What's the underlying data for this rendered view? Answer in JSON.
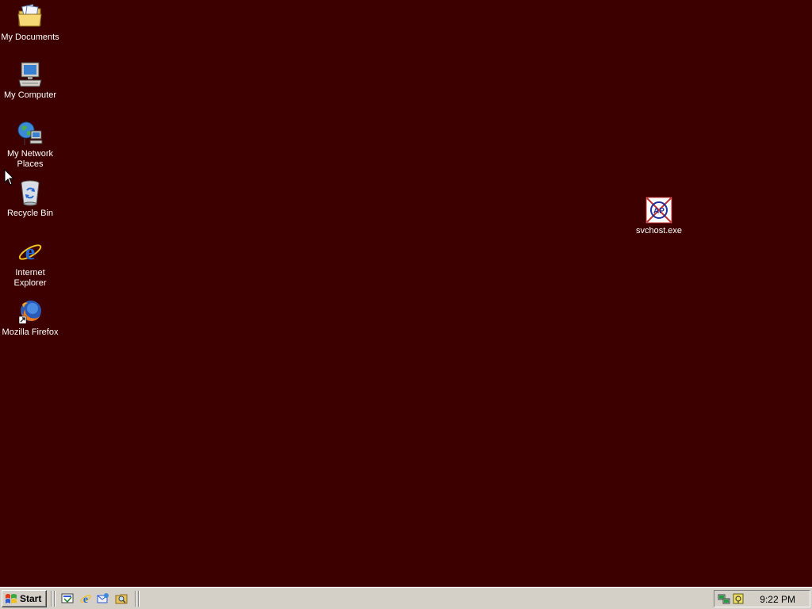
{
  "desktop": {
    "background_color": "#3c0000",
    "icons": [
      {
        "label": "My Documents",
        "icon": "folder-documents-icon"
      },
      {
        "label": "My Computer",
        "icon": "computer-icon"
      },
      {
        "label": "My Network\nPlaces",
        "icon": "network-places-icon"
      },
      {
        "label": "Recycle Bin",
        "icon": "recycle-bin-icon"
      },
      {
        "label": "Internet\nExplorer",
        "icon": "internet-explorer-icon"
      },
      {
        "label": "Mozilla Firefox",
        "icon": "firefox-icon"
      },
      {
        "label": "svchost.exe",
        "icon": "svchost-exe-icon"
      }
    ]
  },
  "taskbar": {
    "start_label": "Start",
    "quick_launch": [
      "show-desktop-icon",
      "internet-explorer-icon",
      "outlook-express-icon",
      "explorer-search-icon"
    ],
    "tray": {
      "icons": [
        "network-connection-icon",
        "security-shield-icon"
      ],
      "clock": "9:22 PM"
    }
  }
}
